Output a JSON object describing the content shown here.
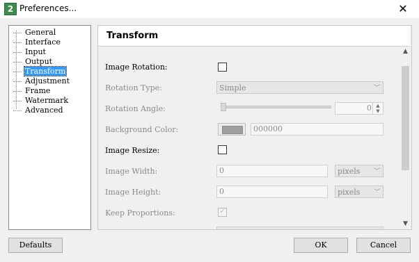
{
  "window": {
    "title": "Preferences...",
    "app_icon_glyph": "2",
    "close_glyph": "✕"
  },
  "tree": {
    "items": [
      {
        "label": "General",
        "selected": false
      },
      {
        "label": "Interface",
        "selected": false
      },
      {
        "label": "Input",
        "selected": false
      },
      {
        "label": "Output",
        "selected": false
      },
      {
        "label": "Transform",
        "selected": true
      },
      {
        "label": "Adjustment",
        "selected": false
      },
      {
        "label": "Frame",
        "selected": false
      },
      {
        "label": "Watermark",
        "selected": false
      },
      {
        "label": "Advanced",
        "selected": false
      }
    ]
  },
  "panel": {
    "title": "Transform",
    "image_rotation": {
      "label": "Image Rotation:",
      "checked": false
    },
    "rotation_type": {
      "label": "Rotation Type:",
      "value": "Simple"
    },
    "rotation_angle": {
      "label": "Rotation Angle:",
      "value": "0",
      "slider_fraction": 0.0
    },
    "background_color": {
      "label": "Background Color:",
      "hex": "000000",
      "swatch_color": "#9e9e9e"
    },
    "image_resize": {
      "label": "Image Resize:",
      "checked": false
    },
    "image_width": {
      "label": "Image Width:",
      "value": "0",
      "unit": "pixels"
    },
    "image_height": {
      "label": "Image Height:",
      "value": "0",
      "unit": "pixels"
    },
    "keep_proportions": {
      "label": "Keep Proportions:",
      "checked": true
    },
    "scroll": {
      "up": "▲",
      "down": "▼"
    }
  },
  "buttons": {
    "defaults": "Defaults",
    "ok": "OK",
    "cancel": "Cancel"
  },
  "colors": {
    "selection": "#3399ff",
    "disabled_text": "#8a8a8a"
  }
}
